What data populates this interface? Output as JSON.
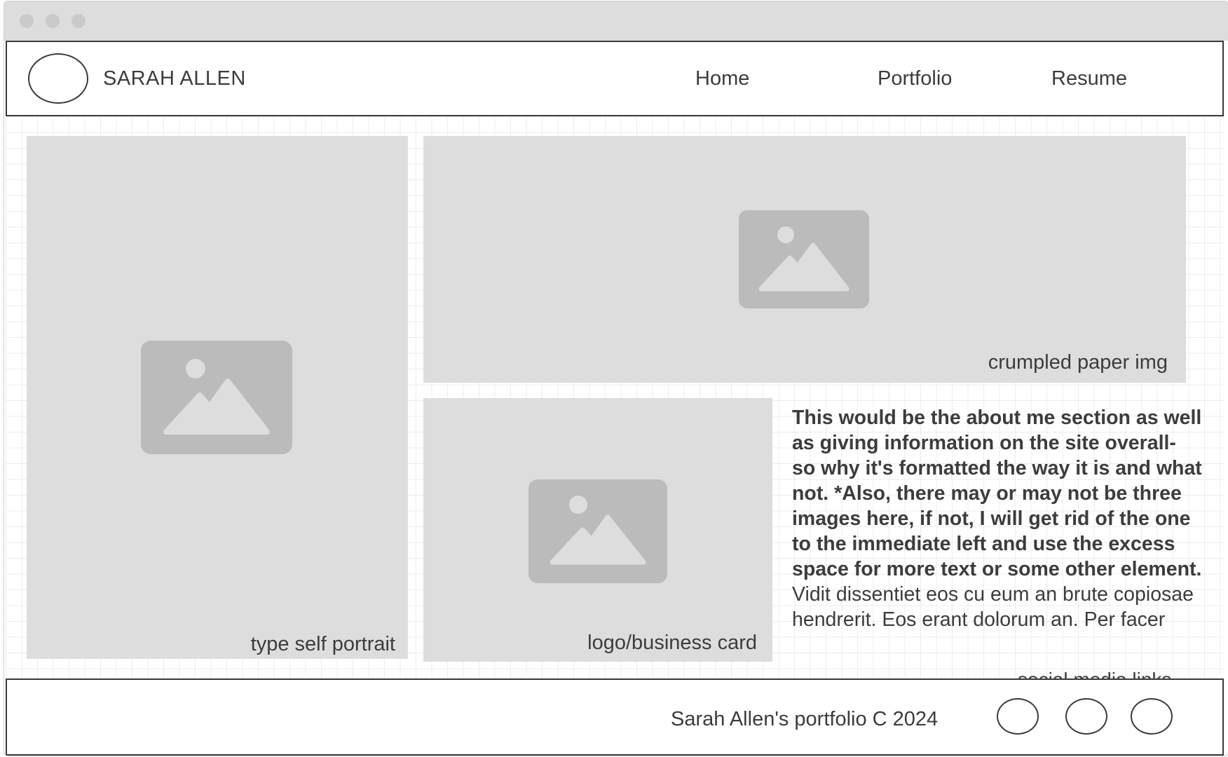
{
  "window": {
    "controls": [
      "close-dot",
      "minimize-dot",
      "maximize-dot"
    ]
  },
  "header": {
    "site_name": "SARAH ALLEN",
    "logo_icon": "circle-placeholder",
    "nav": [
      "Home",
      "Portfolio",
      "Resume"
    ]
  },
  "main": {
    "images": [
      {
        "caption": "type self portrait",
        "icon": "image-placeholder-icon"
      },
      {
        "caption": "crumpled paper img",
        "icon": "image-placeholder-icon"
      },
      {
        "caption": "logo/business card",
        "icon": "image-placeholder-icon"
      }
    ],
    "about": {
      "bold_text": "This would be the about me section as well as giving information on the site overall- so why it's formatted the way it is and what not. *Also, there may or may not be three images here, if not, I will get rid of the one to the immediate left and use the excess space for more text or some other element.",
      "body_text": " Vidit dissentiet eos cu eum an brute copiosae hendrerit. Eos erant dolorum an. Per facer"
    }
  },
  "footer": {
    "social_label": "social media links",
    "copyright": "Sarah Allen's portfolio C 2024",
    "social_icons": [
      "social-link-1",
      "social-link-2",
      "social-link-3"
    ]
  },
  "colors": {
    "placeholder_fill": "#dddddd",
    "icon_fill": "#bbbbbb",
    "border": "#3a3a3a",
    "text": "#3c3c3c",
    "titlebar": "#dddddd",
    "grid": "#ececec"
  }
}
